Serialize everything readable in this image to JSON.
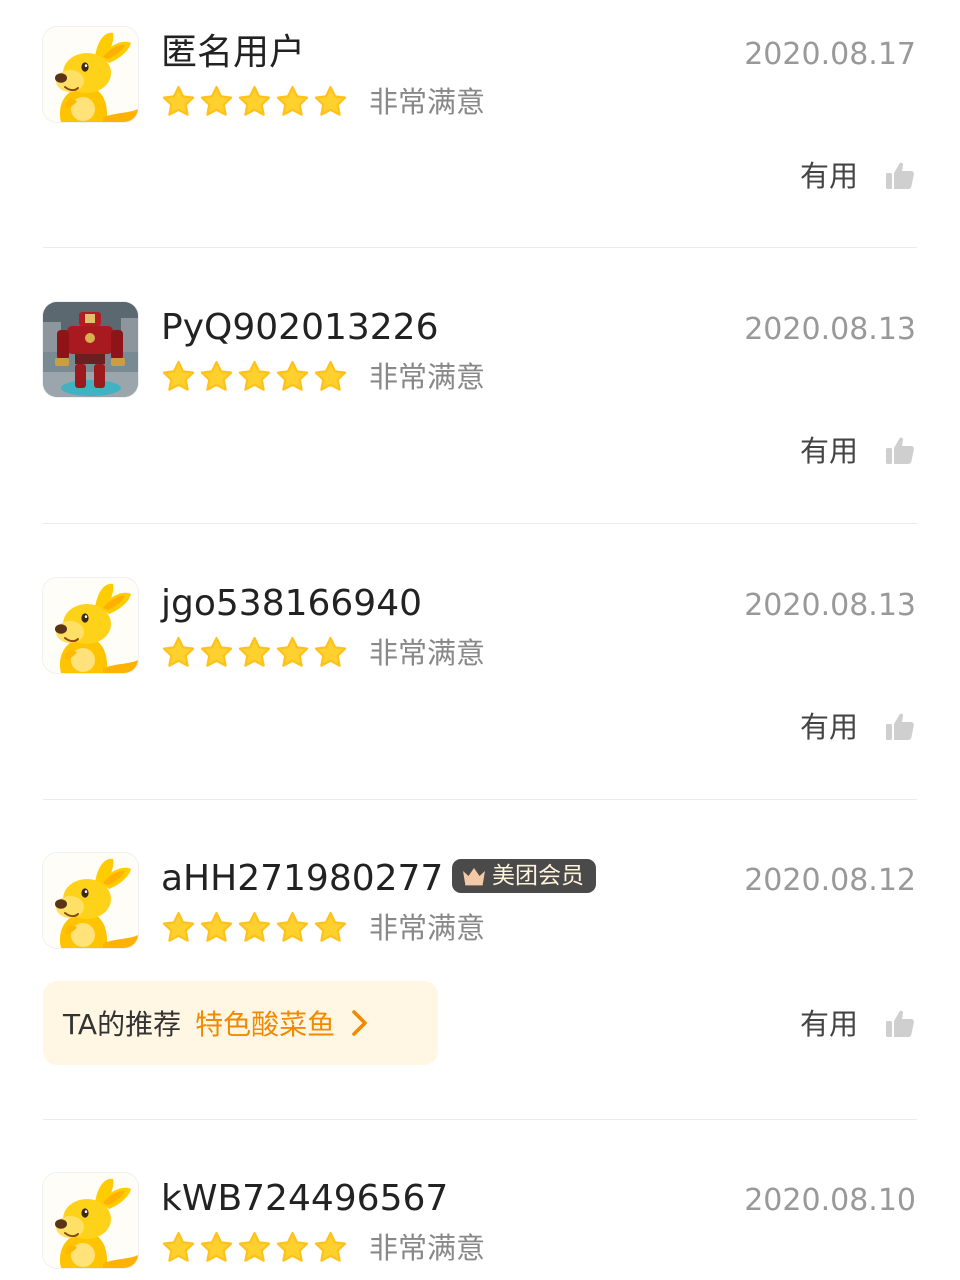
{
  "colors": {
    "star": "#ffd12e",
    "accent_orange": "#f08a00",
    "date_gray": "#999999",
    "recommend_bg": "#fff7e3",
    "badge_bg": "#4a4a4a"
  },
  "reviews": [
    {
      "username": "匿名用户",
      "date": "2020.08.17",
      "rating": 5,
      "rating_text": "非常满意",
      "helpful_label": "有用",
      "avatar": "kangaroo-mascot-icon"
    },
    {
      "username": "PyQ902013226",
      "date": "2020.08.13",
      "rating": 5,
      "rating_text": "非常满意",
      "helpful_label": "有用",
      "avatar": "robot-photo"
    },
    {
      "username": "jgo538166940",
      "date": "2020.08.13",
      "rating": 5,
      "rating_text": "非常满意",
      "helpful_label": "有用",
      "avatar": "kangaroo-mascot-icon"
    },
    {
      "username": "aHH271980277",
      "badge": "美团会员",
      "date": "2020.08.12",
      "rating": 5,
      "rating_text": "非常满意",
      "helpful_label": "有用",
      "recommend_label": "TA的推荐",
      "recommend_dish": "特色酸菜鱼",
      "avatar": "kangaroo-mascot-icon"
    },
    {
      "username": "kWB724496567",
      "date": "2020.08.10",
      "rating": 5,
      "rating_text": "非常满意",
      "avatar": "kangaroo-mascot-icon"
    }
  ]
}
